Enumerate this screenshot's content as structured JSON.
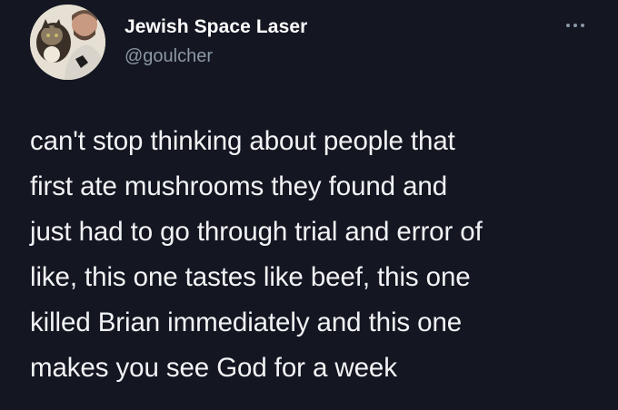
{
  "tweet": {
    "display_name": "Jewish Space Laser",
    "handle": "@goulcher",
    "more_icon": "more-options-icon",
    "avatar_icon": "profile-avatar",
    "text_lines": [
      "can't stop thinking about people that",
      "first ate mushrooms they found and",
      "just had to go through trial and error of",
      "like, this one tastes like beef, this one",
      "killed Brian immediately and this one",
      "makes you see God for a week"
    ]
  },
  "colors": {
    "background": "#141722",
    "name": "#ffffff",
    "handle": "#8b98a5",
    "body_text": "#f2f3f5"
  }
}
